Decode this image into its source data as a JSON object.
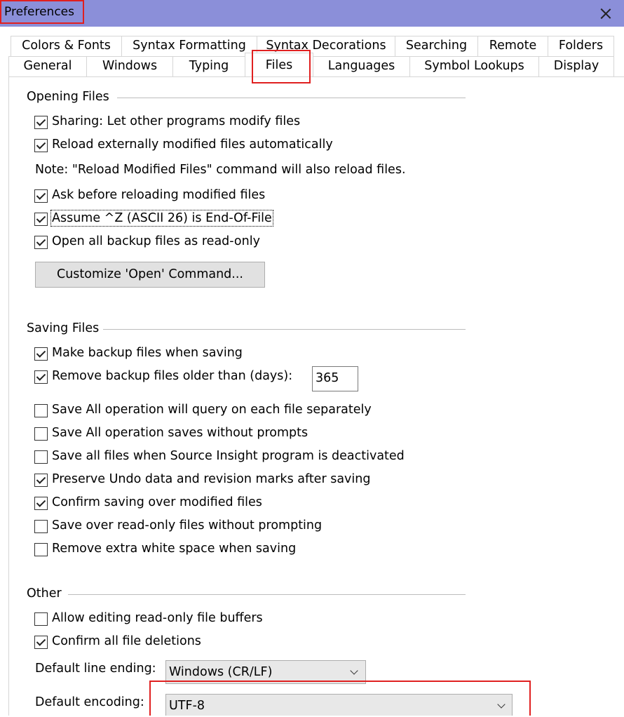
{
  "window": {
    "title": "Preferences"
  },
  "tabs_row1": [
    "Colors & Fonts",
    "Syntax Formatting",
    "Syntax Decorations",
    "Searching",
    "Remote",
    "Folders"
  ],
  "tabs_row2": [
    "General",
    "Windows",
    "Typing",
    "Files",
    "Languages",
    "Symbol Lookups",
    "Display"
  ],
  "selected_tab": "Files",
  "opening": {
    "title": "Opening Files",
    "sharing": "Sharing: Let other programs modify files",
    "reload_auto": "Reload externally modified files automatically",
    "note": "Note: \"Reload Modified Files\" command will also reload files.",
    "ask_reload": "Ask before reloading modified files",
    "assume_eof": "Assume ^Z (ASCII 26) is End-Of-File",
    "open_backup_ro": "Open all backup files as read-only",
    "customize_button": "Customize 'Open' Command..."
  },
  "saving": {
    "title": "Saving Files",
    "make_backup": "Make backup files when saving",
    "remove_backup": "Remove backup files older than (days):",
    "days_value": "365",
    "query_each": "Save All operation will query on each file separately",
    "no_prompts": "Save All operation saves without prompts",
    "deactivated": "Save all files when Source Insight program is deactivated",
    "preserve_undo": "Preserve Undo data and revision marks after saving",
    "confirm_saving": "Confirm saving over modified files",
    "save_ro": "Save over read-only files without prompting",
    "remove_ws": "Remove extra white space when saving"
  },
  "other": {
    "title": "Other",
    "allow_editing_ro": "Allow editing read-only file buffers",
    "confirm_deletions": "Confirm all file deletions",
    "line_ending_label": "Default line ending:",
    "line_ending_value": "Windows (CR/LF)",
    "encoding_label": "Default encoding:",
    "encoding_value": "UTF-8"
  },
  "colors": {
    "titlebar": "#8b8fd9",
    "highlight": "#e02020"
  }
}
